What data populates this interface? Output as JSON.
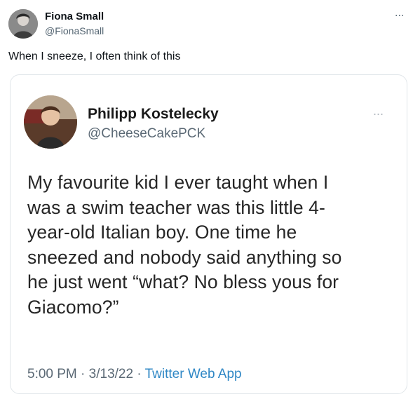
{
  "outer_tweet": {
    "author_name": "Fiona Small",
    "author_handle": "@FionaSmall",
    "more_label": "...",
    "text": "When I sneeze, I often think of this"
  },
  "quoted_tweet": {
    "author_name": "Philipp Kostelecky",
    "author_handle": "@CheeseCakePCK",
    "more_label": "...",
    "text": "My favourite kid I ever taught when I\nwas a swim teacher was this little 4-\nyear-old Italian boy. One time he\nsneezed and nobody said anything so\nhe just went “what? No bless yous for\nGiacomo?”",
    "time": "5:00 PM",
    "separator": " · ",
    "date": "3/13/22",
    "separator2": " · ",
    "source_app": "Twitter Web App"
  },
  "colors": {
    "handle": "#536471",
    "link": "#2f87c5",
    "border": "#e1e6ea"
  }
}
